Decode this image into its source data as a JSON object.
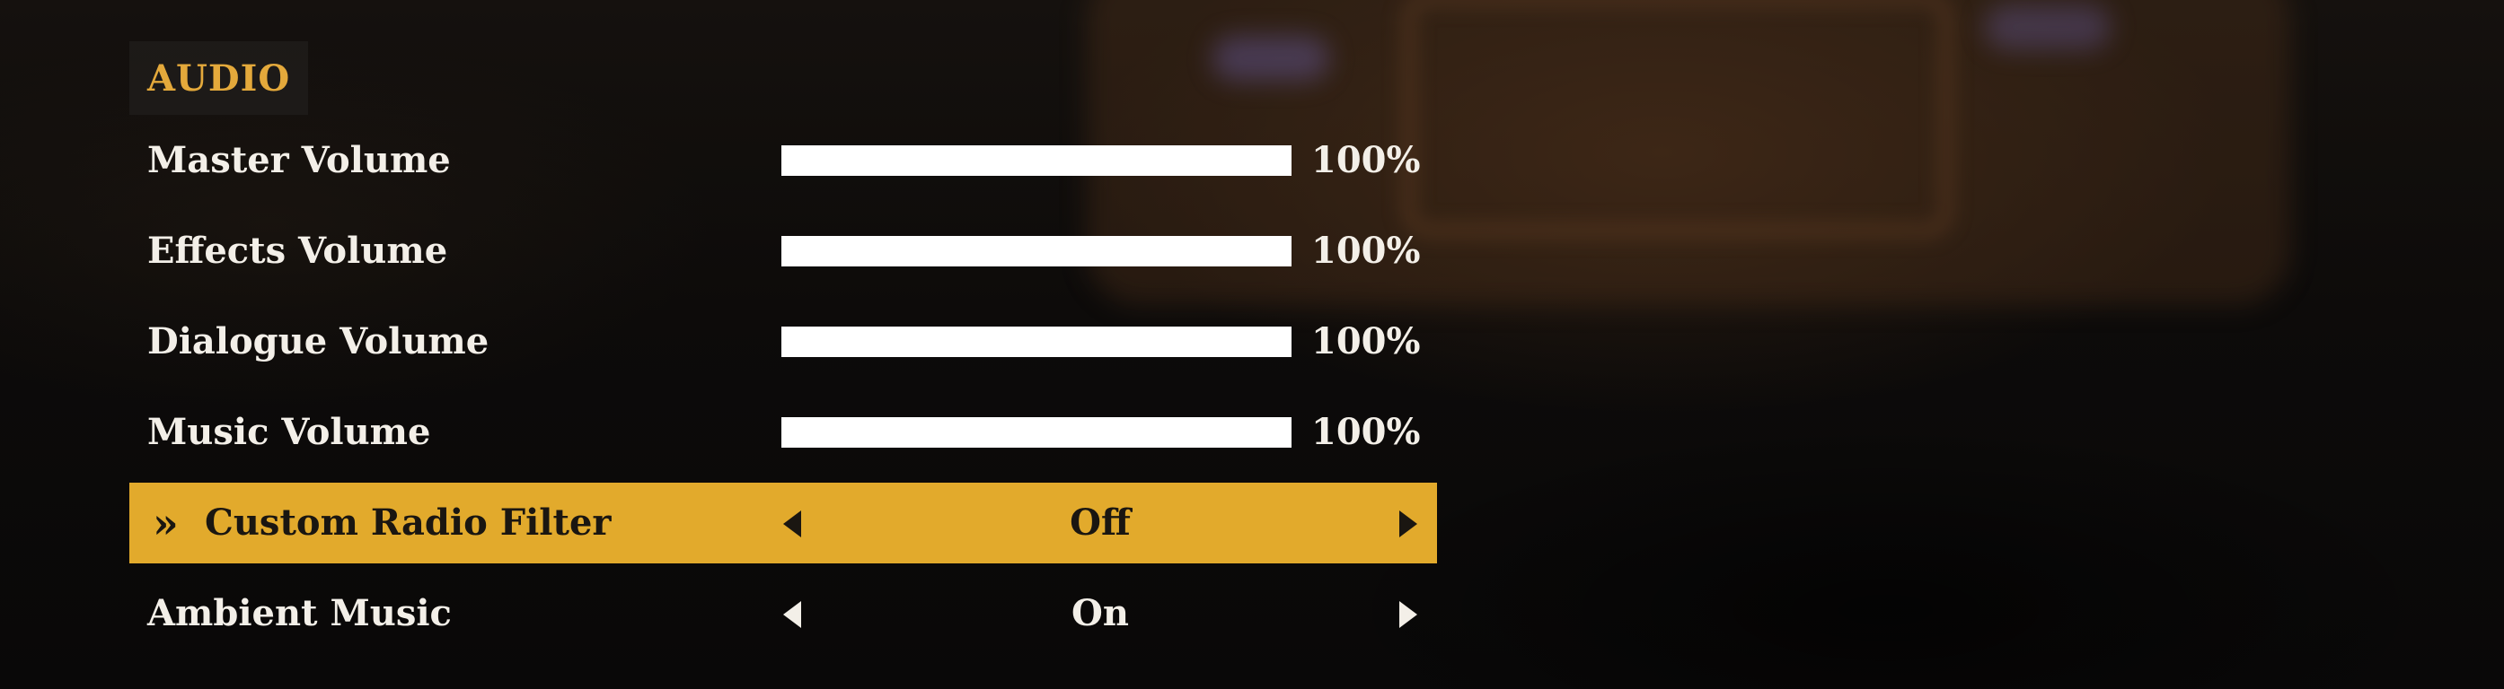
{
  "section": {
    "title": "AUDIO"
  },
  "sliders": [
    {
      "label": "Master Volume",
      "value_text": "100%",
      "fraction": 1.0
    },
    {
      "label": "Effects Volume",
      "value_text": "100%",
      "fraction": 1.0
    },
    {
      "label": "Dialogue Volume",
      "value_text": "100%",
      "fraction": 1.0
    },
    {
      "label": "Music Volume",
      "value_text": "100%",
      "fraction": 1.0
    }
  ],
  "options": [
    {
      "label": "Custom Radio Filter",
      "value": "Off",
      "selected": true
    },
    {
      "label": "Ambient Music",
      "value": "On",
      "selected": false
    }
  ],
  "selection_indicator": "»",
  "colors": {
    "accent": "#e2aa2c",
    "header_text": "#e4a93b",
    "text": "#f3efe8",
    "selected_text": "#1a1611"
  },
  "icons": {
    "selection": "double-chevron-right-icon",
    "prev": "triangle-left-icon",
    "next": "triangle-right-icon"
  }
}
